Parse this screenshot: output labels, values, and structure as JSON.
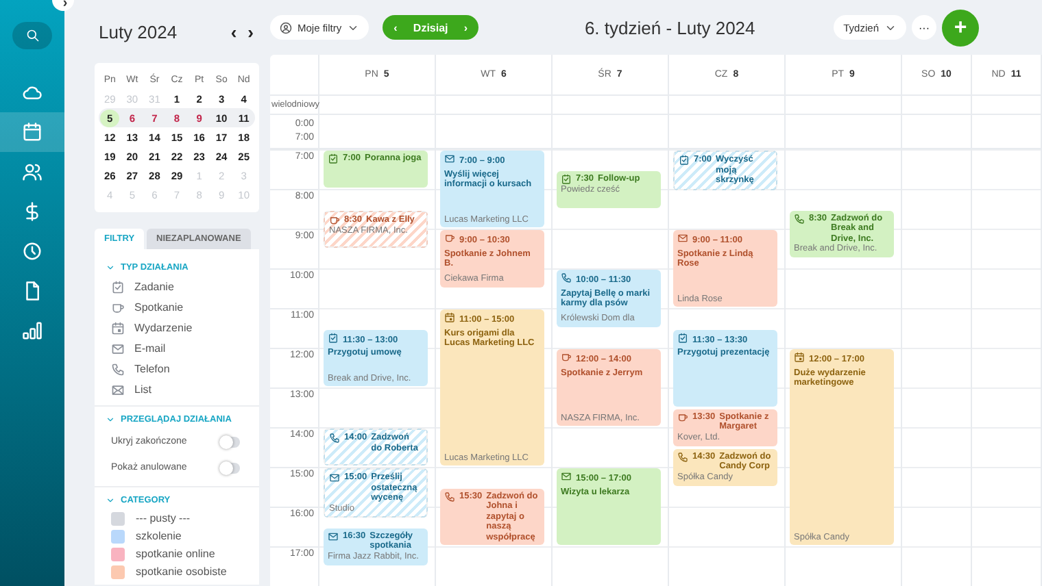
{
  "nav": {
    "collapse": "›",
    "items": [
      {
        "kind": "cloud",
        "selected": false
      },
      {
        "kind": "calendar",
        "selected": true
      },
      {
        "kind": "people",
        "selected": false
      },
      {
        "kind": "dollar",
        "selected": false
      },
      {
        "kind": "clock",
        "selected": false
      },
      {
        "kind": "document",
        "selected": false
      },
      {
        "kind": "chart",
        "selected": false
      }
    ]
  },
  "mini_calendar": {
    "title": "Luty 2024",
    "prev": "‹",
    "next": "›",
    "weekdays": [
      "Pn",
      "Wt",
      "Śr",
      "Cz",
      "Pt",
      "So",
      "Nd"
    ],
    "weeks": [
      {
        "selected": false,
        "days": [
          {
            "label": "29",
            "muted": true,
            "today": false,
            "marked": false
          },
          {
            "label": "30",
            "muted": true,
            "today": false,
            "marked": false
          },
          {
            "label": "31",
            "muted": true,
            "today": false,
            "marked": false
          },
          {
            "label": "1",
            "muted": false,
            "today": false,
            "marked": false
          },
          {
            "label": "2",
            "muted": false,
            "today": false,
            "marked": false
          },
          {
            "label": "3",
            "muted": false,
            "today": false,
            "marked": false
          },
          {
            "label": "4",
            "muted": false,
            "today": false,
            "marked": false
          }
        ]
      },
      {
        "selected": true,
        "days": [
          {
            "label": "5",
            "muted": false,
            "today": true,
            "marked": false
          },
          {
            "label": "6",
            "muted": false,
            "today": false,
            "marked": true
          },
          {
            "label": "7",
            "muted": false,
            "today": false,
            "marked": true
          },
          {
            "label": "8",
            "muted": false,
            "today": false,
            "marked": true
          },
          {
            "label": "9",
            "muted": false,
            "today": false,
            "marked": true
          },
          {
            "label": "10",
            "muted": false,
            "today": false,
            "marked": false
          },
          {
            "label": "11",
            "muted": false,
            "today": false,
            "marked": false
          }
        ]
      },
      {
        "selected": false,
        "days": [
          {
            "label": "12",
            "muted": false,
            "today": false,
            "marked": false
          },
          {
            "label": "13",
            "muted": false,
            "today": false,
            "marked": false
          },
          {
            "label": "14",
            "muted": false,
            "today": false,
            "marked": false
          },
          {
            "label": "15",
            "muted": false,
            "today": false,
            "marked": false
          },
          {
            "label": "16",
            "muted": false,
            "today": false,
            "marked": false
          },
          {
            "label": "17",
            "muted": false,
            "today": false,
            "marked": false
          },
          {
            "label": "18",
            "muted": false,
            "today": false,
            "marked": false
          }
        ]
      },
      {
        "selected": false,
        "days": [
          {
            "label": "19",
            "muted": false,
            "today": false,
            "marked": false
          },
          {
            "label": "20",
            "muted": false,
            "today": false,
            "marked": false
          },
          {
            "label": "21",
            "muted": false,
            "today": false,
            "marked": false
          },
          {
            "label": "22",
            "muted": false,
            "today": false,
            "marked": false
          },
          {
            "label": "23",
            "muted": false,
            "today": false,
            "marked": false
          },
          {
            "label": "24",
            "muted": false,
            "today": false,
            "marked": false
          },
          {
            "label": "25",
            "muted": false,
            "today": false,
            "marked": false
          }
        ]
      },
      {
        "selected": false,
        "days": [
          {
            "label": "26",
            "muted": false,
            "today": false,
            "marked": false
          },
          {
            "label": "27",
            "muted": false,
            "today": false,
            "marked": false
          },
          {
            "label": "28",
            "muted": false,
            "today": false,
            "marked": false
          },
          {
            "label": "29",
            "muted": false,
            "today": false,
            "marked": false
          },
          {
            "label": "1",
            "muted": true,
            "today": false,
            "marked": false
          },
          {
            "label": "2",
            "muted": true,
            "today": false,
            "marked": false
          },
          {
            "label": "3",
            "muted": true,
            "today": false,
            "marked": false
          }
        ]
      },
      {
        "selected": false,
        "days": [
          {
            "label": "4",
            "muted": true,
            "today": false,
            "marked": false
          },
          {
            "label": "5",
            "muted": true,
            "today": false,
            "marked": false
          },
          {
            "label": "6",
            "muted": true,
            "today": false,
            "marked": false
          },
          {
            "label": "7",
            "muted": true,
            "today": false,
            "marked": false
          },
          {
            "label": "8",
            "muted": true,
            "today": false,
            "marked": false
          },
          {
            "label": "9",
            "muted": true,
            "today": false,
            "marked": false
          },
          {
            "label": "10",
            "muted": true,
            "today": false,
            "marked": false
          }
        ]
      }
    ]
  },
  "panel_tabs": [
    {
      "label": "FILTRY",
      "selected": true
    },
    {
      "label": "NIEZAPLANOWANE",
      "selected": false
    }
  ],
  "activity_types": {
    "title": "TYP DZIAŁANIA",
    "items": [
      {
        "kind": "task",
        "label": "Zadanie"
      },
      {
        "kind": "meeting",
        "label": "Spotkanie"
      },
      {
        "kind": "event",
        "label": "Wydarzenie"
      },
      {
        "kind": "email",
        "label": "E-mail"
      },
      {
        "kind": "phone",
        "label": "Telefon"
      },
      {
        "kind": "letter",
        "label": "List"
      }
    ]
  },
  "browse": {
    "title": "PRZEGLĄDAJ DZIAŁANIA",
    "toggles": [
      {
        "label": "Ukryj zakończone",
        "on": false
      },
      {
        "label": "Pokaż anulowane",
        "on": false
      }
    ]
  },
  "category": {
    "title": "CATEGORY",
    "items": [
      {
        "label": "--- pusty ---",
        "color": "#d5d8de"
      },
      {
        "label": "szkolenie",
        "color": "#b9d8fb"
      },
      {
        "label": "spotkanie online",
        "color": "#f9b3c0"
      },
      {
        "label": "spotkanie osobiste",
        "color": "#fcc9b0"
      }
    ]
  },
  "toolbar": {
    "filters": "Moje filtry",
    "prev": "‹",
    "today": "Dzisiaj",
    "next": "›",
    "title": "6. tydzień - Luty 2024",
    "view": "Tydzień",
    "more": "···",
    "add": "+"
  },
  "time_axis": {
    "all_day": "wielodniowy",
    "collapsed": [
      "0:00",
      "7:00"
    ],
    "hours": [
      "7:00",
      "8:00",
      "9:00",
      "10:00",
      "11:00",
      "12:00",
      "13:00",
      "14:00",
      "15:00",
      "16:00",
      "17:00"
    ]
  },
  "days": [
    {
      "weekday": "PN",
      "date": "5",
      "events": [
        {
          "kind": "task",
          "time": "7:00",
          "title": "Poranna joga",
          "color": "#d3f1c2",
          "hatched": false
        },
        {
          "kind": "meeting",
          "time": "8:30",
          "title": "Kawa z Elly",
          "company": "NASZA FIRMA, Inc.",
          "color": "#fdd6c8",
          "hatched": true
        },
        {
          "kind": "task",
          "time": "11:30 – 13:00",
          "title": "Przygotuj umowę",
          "company": "Break and Drive, Inc.",
          "color": "#cdebf9",
          "hatched": false
        },
        {
          "kind": "phone",
          "time": "14:00",
          "title": "Zadzwoń do Roberta",
          "color": "#cdebf9",
          "hatched": true
        },
        {
          "kind": "email",
          "time": "15:00",
          "title": "Prześlij ostateczną wycenę",
          "company": "Studio",
          "color": "#cdebf9",
          "hatched": true
        },
        {
          "kind": "email",
          "time": "16:30",
          "title": "Szczegóły spotkania",
          "company": "Firma Jazz Rabbit, Inc.",
          "color": "#cdebf9",
          "hatched": false
        }
      ]
    },
    {
      "weekday": "WT",
      "date": "6",
      "events": [
        {
          "kind": "email",
          "time": "7:00 – 9:00",
          "title": "Wyślij więcej informacji o kursach",
          "company": "Lucas Marketing LLC",
          "color": "#cdebf9",
          "hatched": false
        },
        {
          "kind": "meeting",
          "time": "9:00 – 10:30",
          "title": "Spotkanie z Johnem B.",
          "company": "Ciekawa Firma",
          "color": "#fdd6c8",
          "hatched": false
        },
        {
          "kind": "event",
          "time": "11:00 – 15:00",
          "title": "Kurs origami dla Lucas Marketing LLC",
          "company": "Lucas Marketing LLC",
          "color": "#fbe6bc",
          "hatched": false
        },
        {
          "kind": "phone",
          "time": "15:30",
          "title": "Zadzwoń do Johna i zapytaj o naszą współpracę",
          "color": "#fdd6c8",
          "hatched": false
        }
      ]
    },
    {
      "weekday": "ŚR",
      "date": "7",
      "events": [
        {
          "kind": "task",
          "time": "7:30",
          "title": "Follow-up",
          "company": "Powiedz cześć",
          "color": "#d3f1c2",
          "hatched": false
        },
        {
          "kind": "phone",
          "time": "10:00 – 11:30",
          "title": "Zapytaj Bellę o marki karmy dla psów",
          "company": "Królewski Dom dla",
          "color": "#cdebf9",
          "hatched": false
        },
        {
          "kind": "meeting",
          "time": "12:00 – 14:00",
          "title": "Spotkanie z Jerrym",
          "company": "NASZA FIRMA, Inc.",
          "color": "#fdd6c8",
          "hatched": false
        },
        {
          "kind": "email",
          "time": "15:00 – 17:00",
          "title": "Wizyta u lekarza",
          "color": "#d3f1c2",
          "hatched": false
        }
      ]
    },
    {
      "weekday": "CZ",
      "date": "8",
      "events": [
        {
          "kind": "task",
          "time": "7:00",
          "title": "Wyczyść moją skrzynkę",
          "color": "#cdebf9",
          "hatched": true
        },
        {
          "kind": "email",
          "time": "9:00 – 11:00",
          "title": "Spotkanie z Lindą Rose",
          "company": "Linda Rose",
          "color": "#fdd6c8",
          "hatched": false
        },
        {
          "kind": "task",
          "time": "11:30 – 13:30",
          "title": "Przygotuj prezentację",
          "color": "#cdebf9",
          "hatched": false
        },
        {
          "kind": "meeting",
          "time": "13:30",
          "title": "Spotkanie z Margaret",
          "company": "Kover, Ltd.",
          "color": "#fdd6c8",
          "hatched": false
        },
        {
          "kind": "phone",
          "time": "14:30",
          "title": "Zadzwoń do Candy Corp",
          "company": "Spółka Candy",
          "color": "#fbe6bc",
          "hatched": false
        }
      ]
    },
    {
      "weekday": "PT",
      "date": "9",
      "events": [
        {
          "kind": "phone",
          "time": "8:30",
          "title": "Zadzwoń do Break and Drive, Inc.",
          "company": "Break and Drive, Inc.",
          "color": "#d3f1c2",
          "hatched": false
        },
        {
          "kind": "event",
          "time": "12:00 – 17:00",
          "title": "Duże wydarzenie marketingowe",
          "company": "Spółka Candy",
          "color": "#fbe6bc",
          "hatched": false
        }
      ]
    },
    {
      "weekday": "SO",
      "date": "10"
    },
    {
      "weekday": "ND",
      "date": "11"
    }
  ]
}
